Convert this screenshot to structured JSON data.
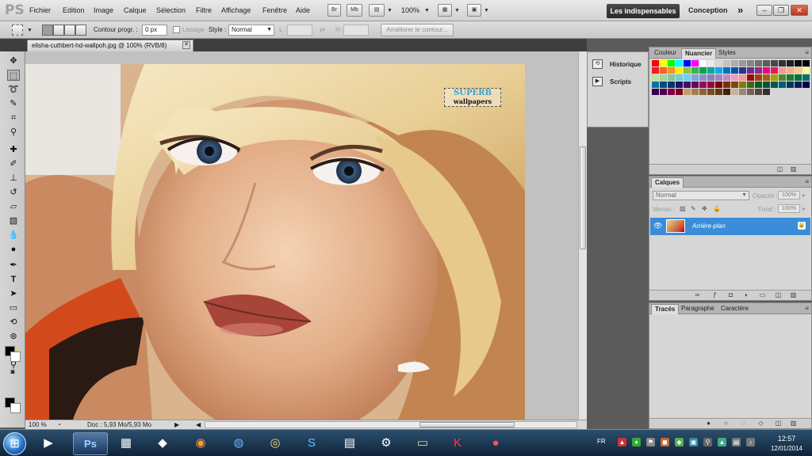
{
  "app": {
    "logo": "PS"
  },
  "menu": [
    "Fichier",
    "Edition",
    "Image",
    "Calque",
    "Sélection",
    "Filtre",
    "Affichage",
    "Fenêtre",
    "Aide"
  ],
  "appbar": {
    "br_label": "Br",
    "mb_label": "Mb",
    "zoom": "100%",
    "arrange_icon": "arrange-icon",
    "screen_mode_icon": "screen-mode-icon"
  },
  "workspace": {
    "active": "Les indispensables",
    "alt": "Conception",
    "more": "»"
  },
  "options": {
    "feather_label": "Contour progr. :",
    "feather_value": "0 px",
    "antialias_label": "Lissage",
    "style_label": "Style :",
    "style_value": "Normal",
    "width_label": "L :",
    "height_label": "H :",
    "refine_button": "Améliorer le contour..."
  },
  "document": {
    "tab_title": "elisha-cuthbert-hd-wallpoh.jpg @ 100% (RVB/8)",
    "watermark_line1": "SUPERB",
    "watermark_line2": "wallpapers",
    "zoom": "100 %",
    "doc_info": "Doc : 5,93 Mo/5,93 Mo"
  },
  "dock": [
    {
      "label": "Historique",
      "icon": "history-icon"
    },
    {
      "label": "Scripts",
      "icon": "actions-icon"
    }
  ],
  "swatches_panel": {
    "tabs": [
      "Couleur",
      "Nuancier",
      "Styles"
    ],
    "active_tab": "Nuancier",
    "colors": [
      [
        "#ff0000",
        "#ffff00",
        "#00ff00",
        "#00ffff",
        "#0000ff",
        "#ff00ff",
        "#ffffff",
        "#ebebeb",
        "#d6d6d6",
        "#c2c2c2",
        "#adadad",
        "#999999",
        "#858585",
        "#707070",
        "#5c5c5c",
        "#474747",
        "#333333",
        "#1f1f1f",
        "#0a0a0a",
        "#000000"
      ],
      [
        "#ed1c24",
        "#f26522",
        "#f7941d",
        "#fff200",
        "#8dc63f",
        "#39b54a",
        "#00a651",
        "#00a99d",
        "#00aeef",
        "#0072bc",
        "#0054a6",
        "#2e3192",
        "#662d91",
        "#92278f",
        "#ec008c",
        "#ed145b",
        "#f6989d",
        "#f9ad81",
        "#fdc689",
        "#fff799"
      ],
      [
        "#c4df9b",
        "#a3d39c",
        "#82ca9c",
        "#7accc8",
        "#6dcff6",
        "#7da7d9",
        "#8393ca",
        "#8781bd",
        "#a186be",
        "#bd8cbf",
        "#f49ac1",
        "#f5989d",
        "#9e0b0f",
        "#a0410d",
        "#a3620a",
        "#aba000",
        "#598527",
        "#1a7b30",
        "#007236",
        "#00746b"
      ],
      [
        "#0076a3",
        "#004b80",
        "#003471",
        "#1b1464",
        "#440e62",
        "#630460",
        "#9e005d",
        "#9e0039",
        "#790000",
        "#7b2e00",
        "#7d4900",
        "#827b00",
        "#406618",
        "#005e20",
        "#005826",
        "#005952",
        "#005b7f",
        "#003663",
        "#002157",
        "#0d004c"
      ],
      [
        "#32004b",
        "#4b0049",
        "#7b0046",
        "#7a0026",
        "#c69c6d",
        "#a67c52",
        "#8c6239",
        "#754c24",
        "#603913",
        "#42210b",
        "#c7b299",
        "#998675",
        "#736357",
        "#534741",
        "#362f2d"
      ]
    ]
  },
  "layers_panel": {
    "tabs": [
      "Calques"
    ],
    "blend_mode": "Normal",
    "opacity_label": "Opacité :",
    "opacity_value": "100%",
    "lock_label": "Verrou :",
    "fill_label": "Fond :",
    "fill_value": "100%",
    "layer_name": "Arrière-plan"
  },
  "paths_panel": {
    "tabs": [
      "Tracés",
      "Paragraphe",
      "Caractère"
    ],
    "active_tab": "Tracés"
  },
  "taskbar": {
    "ps_label": "Ps",
    "lang": "FR",
    "time": "12:57",
    "date": "12/01/2014"
  },
  "colors": {
    "selection_blue": "#3b8cd9",
    "panel_gray": "#d6d6d6",
    "dark_bg": "#5a5a5a"
  }
}
